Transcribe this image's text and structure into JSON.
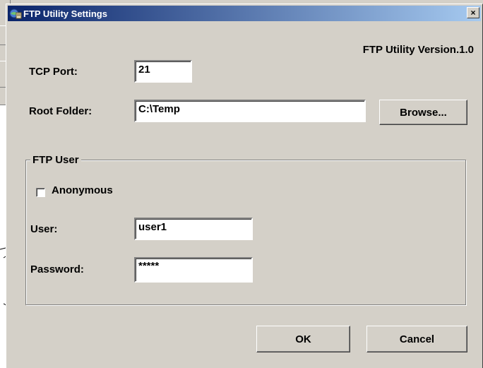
{
  "dialog": {
    "title": "FTP Utility Settings",
    "close_label": "×",
    "version": "FTP Utility Version.1.0",
    "tcp_port": {
      "label": "TCP Port:",
      "value": "21"
    },
    "root_folder": {
      "label": "Root Folder:",
      "value": "C:\\Temp",
      "browse_label": "Browse..."
    },
    "ftp_user": {
      "legend": "FTP User",
      "anonymous_label": "Anonymous",
      "anonymous_checked": false,
      "user": {
        "label": "User:",
        "value": "user1"
      },
      "password": {
        "label": "Password:",
        "value": "*****"
      }
    },
    "ok_label": "OK",
    "cancel_label": "Cancel"
  },
  "icons": {
    "title": "ftp-app-icon",
    "close": "close-icon",
    "checkbox": "checkbox-unchecked"
  }
}
